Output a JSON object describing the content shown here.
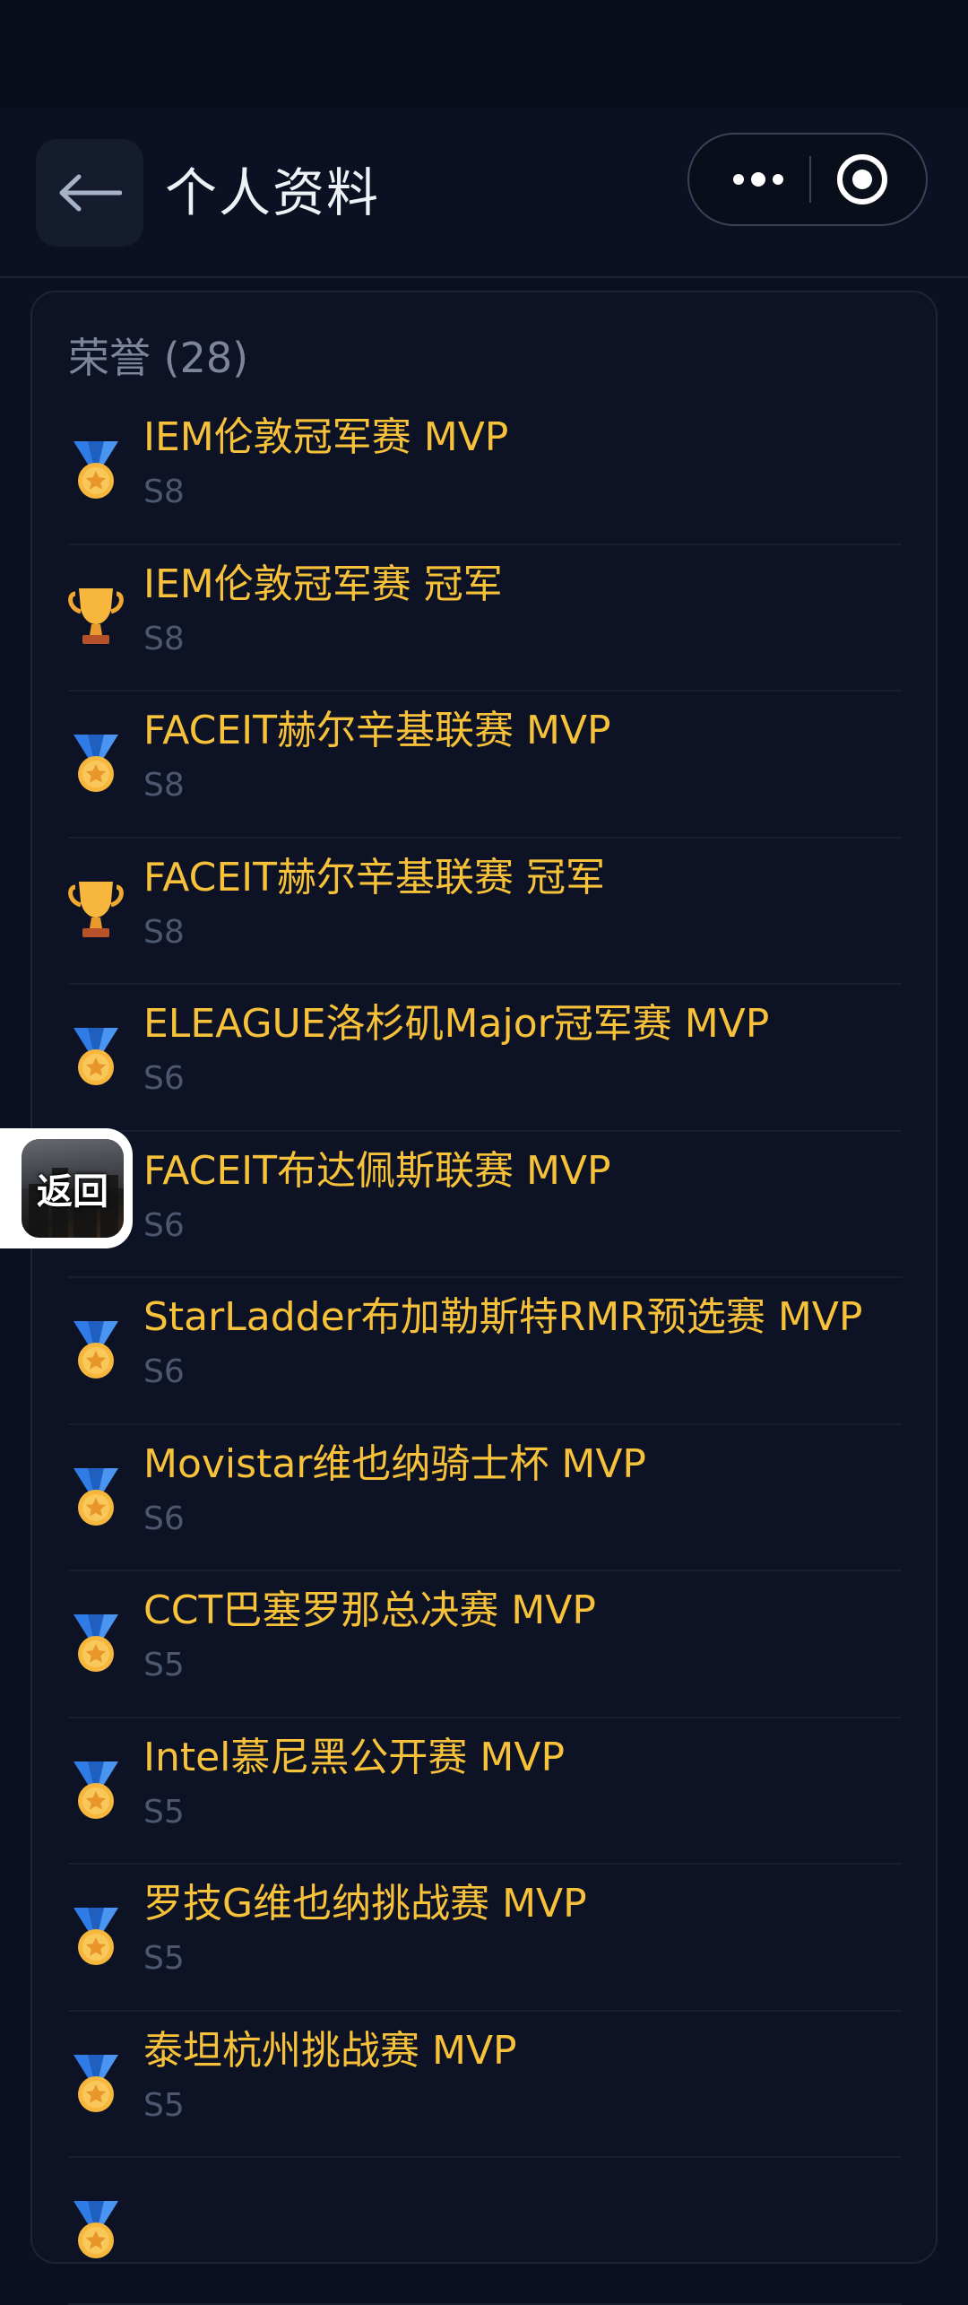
{
  "navbar": {
    "title": "个人资料"
  },
  "honors": {
    "title": "荣誉 (28)",
    "items": [
      {
        "name": "IEM伦敦冠军赛 MVP",
        "season": "S8",
        "icon": "medal"
      },
      {
        "name": "IEM伦敦冠军赛 冠军",
        "season": "S8",
        "icon": "trophy"
      },
      {
        "name": "FACEIT赫尔辛基联赛 MVP",
        "season": "S8",
        "icon": "medal"
      },
      {
        "name": "FACEIT赫尔辛基联赛 冠军",
        "season": "S8",
        "icon": "trophy"
      },
      {
        "name": "ELEAGUE洛杉矶Major冠军赛 MVP",
        "season": "S6",
        "icon": "medal"
      },
      {
        "name": "FACEIT布达佩斯联赛 MVP",
        "season": "S6",
        "icon": "medal"
      },
      {
        "name": "StarLadder布加勒斯特RMR预选赛 MVP",
        "season": "S6",
        "icon": "medal"
      },
      {
        "name": "Movistar维也纳骑士杯 MVP",
        "season": "S6",
        "icon": "medal"
      },
      {
        "name": "CCT巴塞罗那总决赛 MVP",
        "season": "S5",
        "icon": "medal"
      },
      {
        "name": "Intel慕尼黑公开赛 MVP",
        "season": "S5",
        "icon": "medal"
      },
      {
        "name": "罗技G维也纳挑战赛 MVP",
        "season": "S5",
        "icon": "medal"
      },
      {
        "name": "泰坦杭州挑战赛 MVP",
        "season": "S5",
        "icon": "medal"
      },
      {
        "name": "",
        "season": "",
        "icon": "medal"
      }
    ]
  },
  "floating_return": {
    "label": "返回"
  },
  "colors": {
    "background": "#0b1122",
    "accent_gold": "#f7c23a",
    "muted_text": "#4d5770"
  }
}
